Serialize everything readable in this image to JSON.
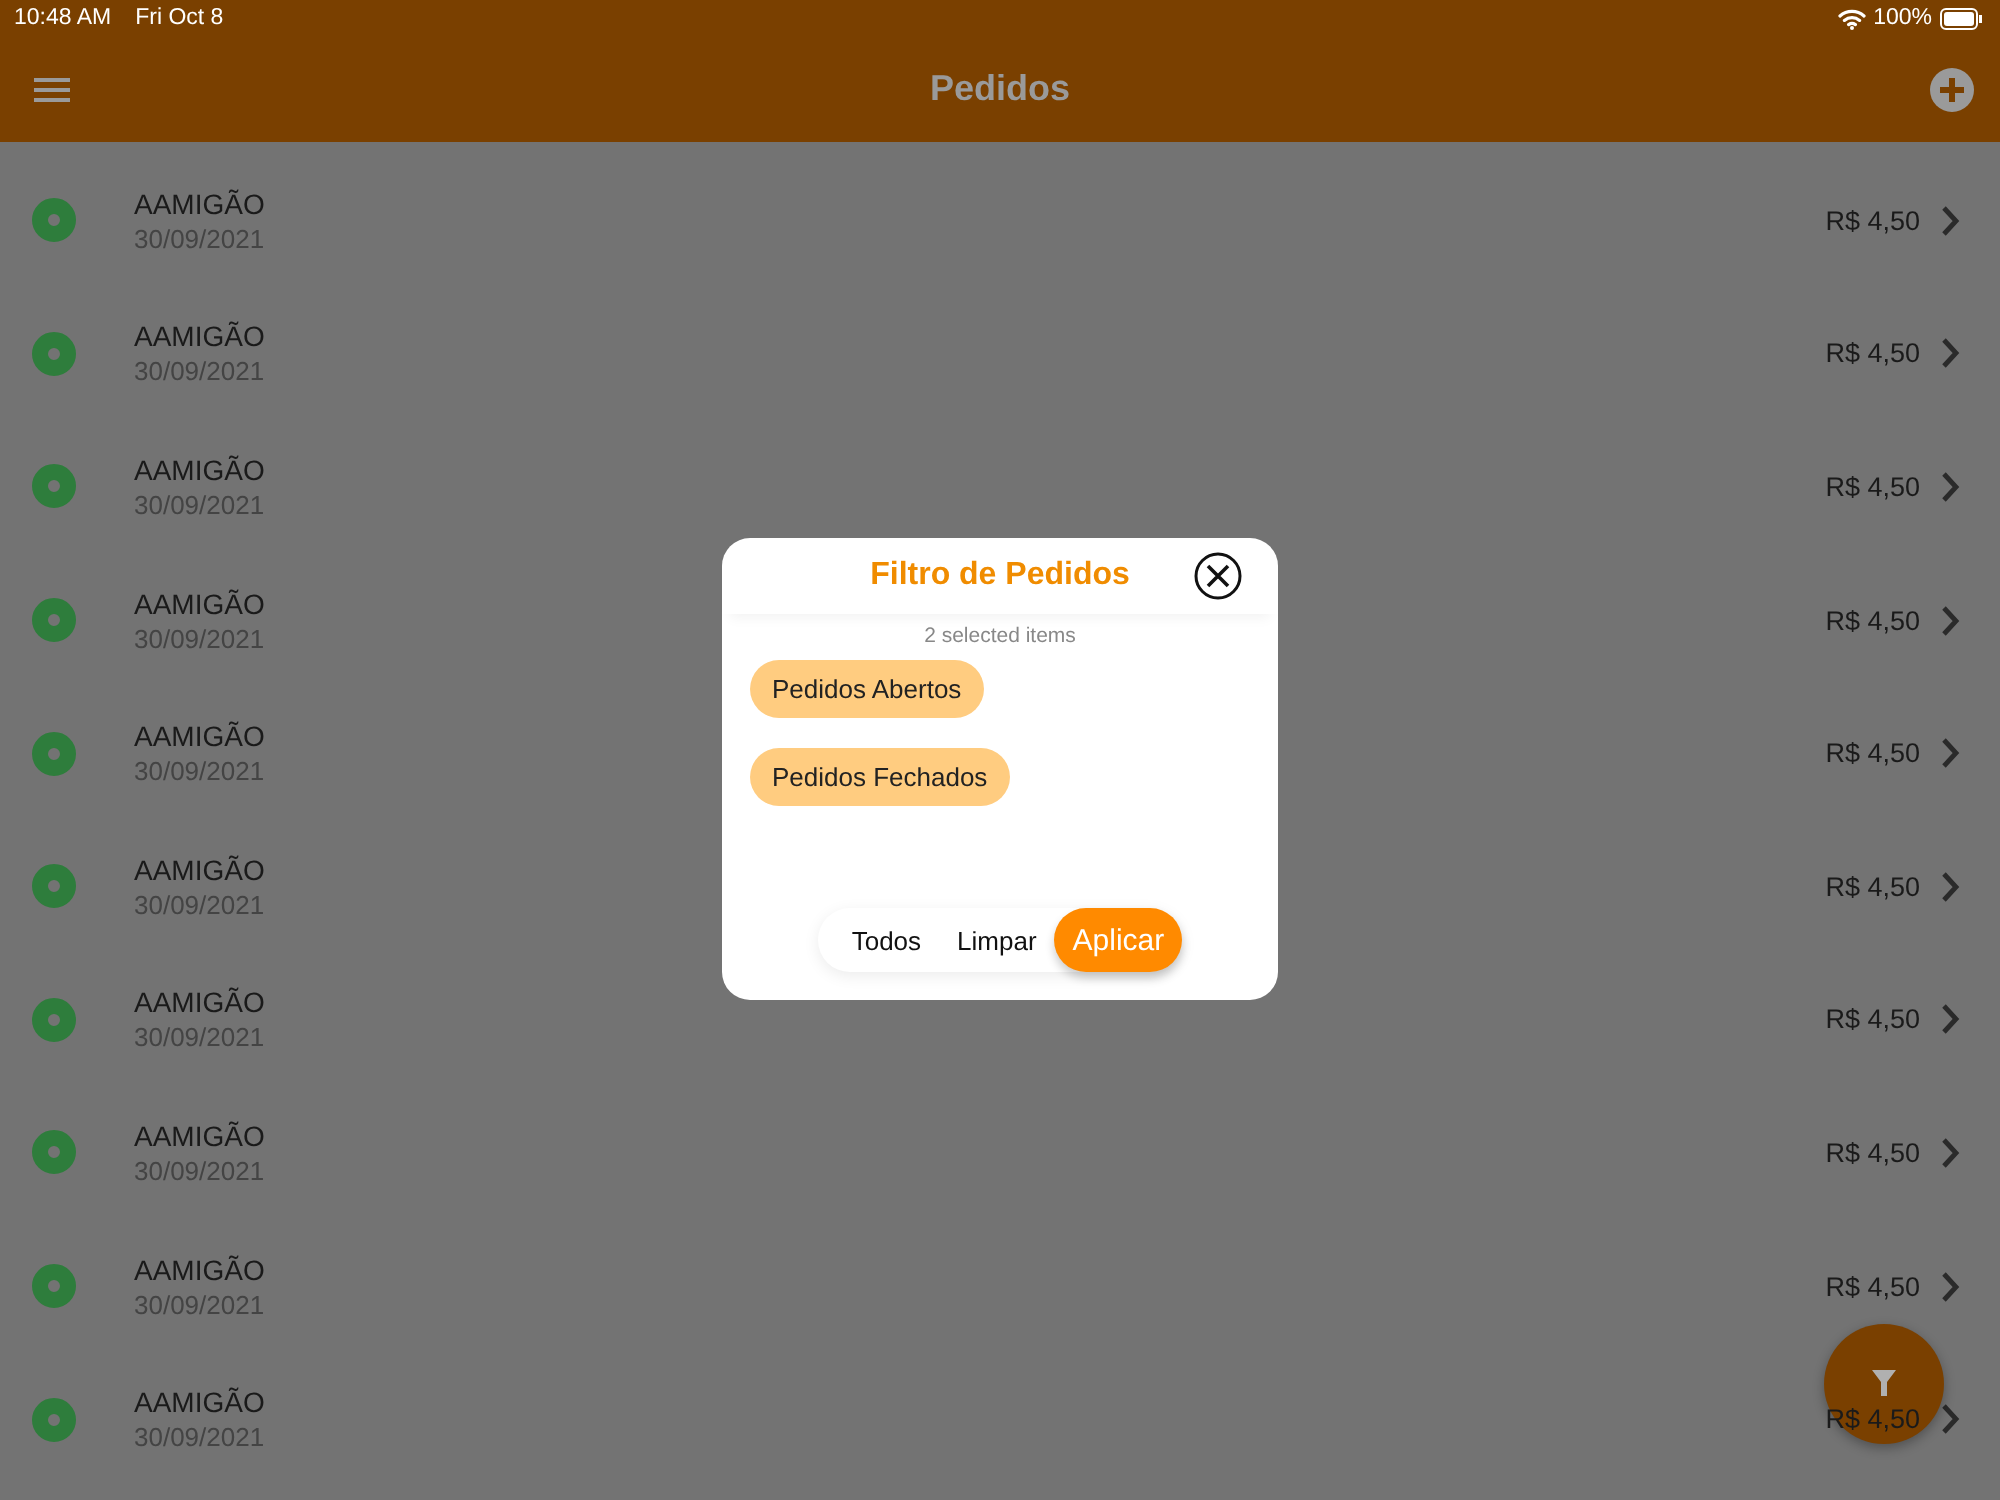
{
  "status_bar": {
    "time": "10:48 AM",
    "date": "Fri Oct 8",
    "battery": "100%"
  },
  "header": {
    "title": "Pedidos"
  },
  "orders": [
    {
      "name": "AAMIGÃO",
      "date": "30/09/2021",
      "price": "R$ 4,50",
      "color": "#2e7d3c"
    },
    {
      "name": "AAMIGÃO",
      "date": "30/09/2021",
      "price": "R$ 4,50",
      "color": "#2e7d3c"
    },
    {
      "name": "AAMIGÃO",
      "date": "30/09/2021",
      "price": "R$ 4,50",
      "color": "#2e7d3c"
    },
    {
      "name": "AAMIGÃO",
      "date": "30/09/2021",
      "price": "R$ 4,50",
      "color": "#2e7d3c"
    },
    {
      "name": "AAMIGÃO",
      "date": "30/09/2021",
      "price": "R$ 4,50",
      "color": "#2e7d3c"
    },
    {
      "name": "AAMIGÃO",
      "date": "30/09/2021",
      "price": "R$ 4,50",
      "color": "#2e7d3c"
    },
    {
      "name": "AAMIGÃO",
      "date": "30/09/2021",
      "price": "R$ 4,50",
      "color": "#2e7d3c"
    },
    {
      "name": "AAMIGÃO",
      "date": "30/09/2021",
      "price": "R$ 4,50",
      "color": "#2e7d3c"
    },
    {
      "name": "AAMIGÃO",
      "date": "30/09/2021",
      "price": "R$ 4,50",
      "color": "#2e7d3c"
    },
    {
      "name": "AAMIGÃO",
      "date": "30/09/2021",
      "price": "R$ 4,50",
      "color": "#2e7d3c"
    }
  ],
  "filter_dialog": {
    "title": "Filtro de Pedidos",
    "summary": "2 selected items",
    "options": [
      {
        "label": "Pedidos Abertos",
        "selected": true
      },
      {
        "label": "Pedidos Fechados",
        "selected": true
      }
    ],
    "buttons": [
      {
        "label": "Todos",
        "kind": "plain"
      },
      {
        "label": "Limpar",
        "kind": "plain"
      },
      {
        "label": "Aplicar",
        "kind": "primary"
      }
    ]
  }
}
